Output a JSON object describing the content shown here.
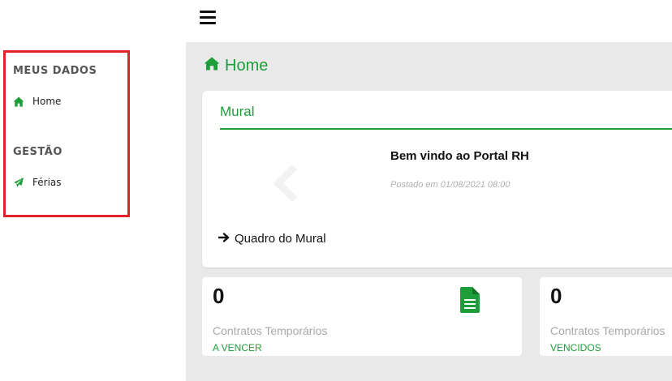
{
  "sidebar": {
    "sections": [
      {
        "title": "MEUS DADOS",
        "items": [
          {
            "label": "Home",
            "icon": "home-icon"
          }
        ]
      },
      {
        "title": "GESTÃO",
        "items": [
          {
            "label": "Férias",
            "icon": "plane-icon"
          }
        ]
      }
    ]
  },
  "topbar": {
    "menu_icon": "hamburger-icon"
  },
  "page": {
    "title": "Home",
    "icon": "home-icon"
  },
  "mural": {
    "header": "Mural",
    "post_title": "Bem vindo ao Portal RH",
    "post_date": "Postado em 01/08/2021 08:00",
    "link_label": "Quadro do Mural"
  },
  "stats": [
    {
      "value": "0",
      "label": "Contratos Temporários",
      "sub": "A VENCER",
      "icon": "document-icon"
    },
    {
      "value": "0",
      "label": "Contratos Temporários",
      "sub": "VENCIDOS"
    }
  ],
  "colors": {
    "accent": "#1e9e3a",
    "highlight": "#e32228",
    "background": "#e9e9ea"
  }
}
